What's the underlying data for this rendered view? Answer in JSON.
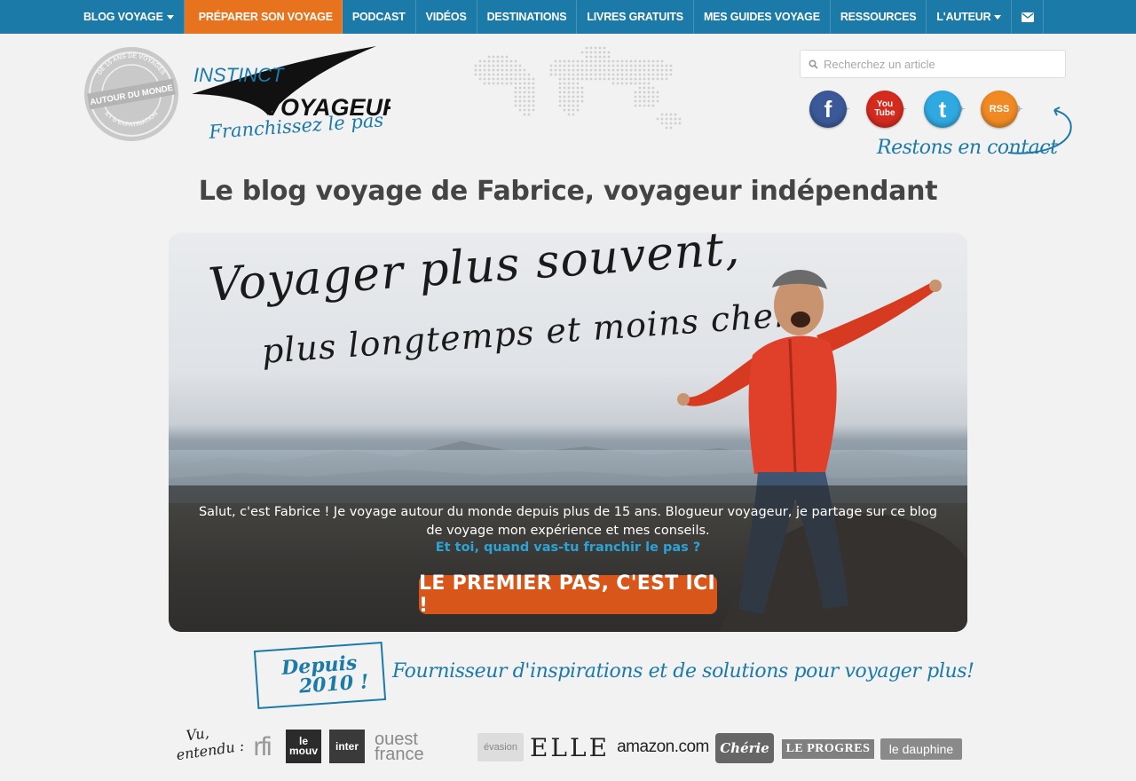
{
  "nav": {
    "items": [
      {
        "label": "BLOG VOYAGE",
        "caret": true
      },
      {
        "label": "PRÉPARER SON VOYAGE",
        "active": true
      },
      {
        "label": "PODCAST"
      },
      {
        "label": "VIDÉOS"
      },
      {
        "label": "DESTINATIONS"
      },
      {
        "label": "LIVRES GRATUITS"
      },
      {
        "label": "MES GUIDES VOYAGE"
      },
      {
        "label": "RESSOURCES"
      },
      {
        "label": "L'AUTEUR",
        "caret": true
      }
    ],
    "mail_icon": "envelope-icon",
    "bg_color": "#1b7aa8",
    "active_color": "#e8731f"
  },
  "logo": {
    "brand_line1": "INSTINCT",
    "brand_line2": "VOYAGEUR",
    "slogan": "Franchissez le pas !",
    "seal_top": "DE 15 ANS DE VOYAGES",
    "seal_center": "AUTOUR DU MONDE",
    "seal_bottom": "ET D'EXPATRIATION"
  },
  "search": {
    "placeholder": "Recherchez un article",
    "icon": "search-icon"
  },
  "social": {
    "items": [
      {
        "name": "facebook",
        "glyph": "f",
        "color": "#3b5998"
      },
      {
        "name": "youtube",
        "glyph": "You Tube",
        "color": "#d42b1e"
      },
      {
        "name": "twitter",
        "glyph": "t",
        "color": "#2fa9e0"
      },
      {
        "name": "rss",
        "glyph": "RSS",
        "color": "#f08a24"
      }
    ],
    "contact_label": "Restons en contact"
  },
  "page_title": "Le blog voyage de Fabrice, voyageur indépendant",
  "hero": {
    "headline1": "Voyager plus souvent,",
    "headline2": "plus longtemps et moins cher !",
    "intro": "Salut, c'est Fabrice ! Je voyage autour du monde depuis plus de 15 ans. Blogueur voyageur, je partage sur ce blog de voyage mon expérience et mes conseils.",
    "link": "Et toi, quand vas-tu franchir le pas ?",
    "cta": "LE PREMIER PAS, C'EST ICI !",
    "cta_color": "#d8561a",
    "link_color": "#2aa3d6"
  },
  "tagline": {
    "stamp_line1": "Depuis",
    "stamp_line2": "2010 !",
    "text": "Fournisseur d'inspirations et de solutions pour voyager plus!"
  },
  "press": {
    "intro_line1": "Vu,",
    "intro_line2": "entendu :",
    "logos": {
      "rfi": "rfi",
      "mouv1": "le",
      "mouv2": "mouv",
      "inter": "inter",
      "ouest1": "ouest",
      "ouest2": "france",
      "evasion": "évasion",
      "elle": "ELLE",
      "amazon": "amazon.com",
      "cherie": "Chérie",
      "progres": "LE PROGRES",
      "dauphine": "le dauphine"
    }
  }
}
